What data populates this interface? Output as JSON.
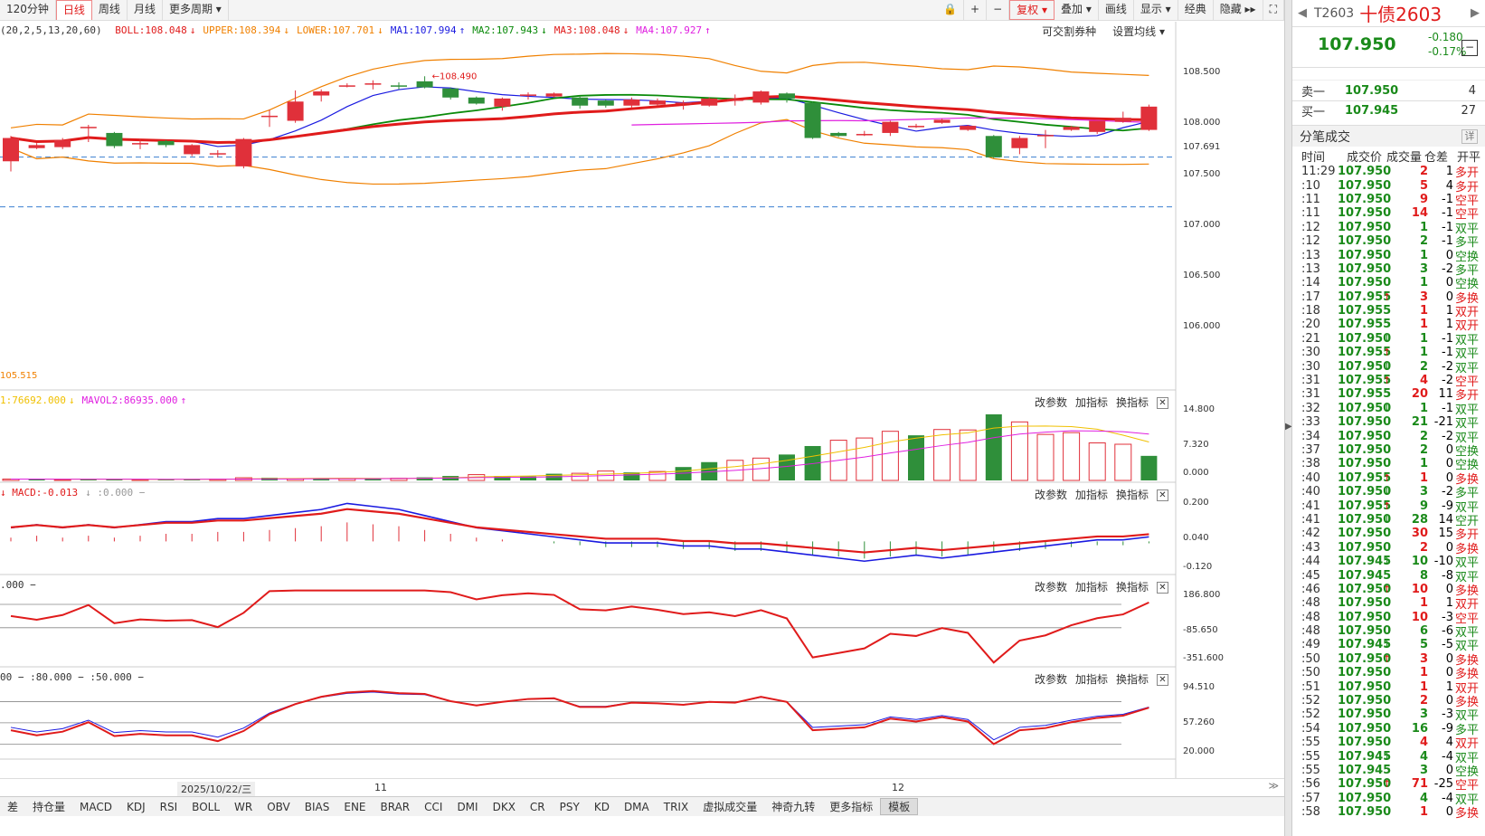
{
  "toolbar": {
    "periods": [
      "120分钟",
      "日线",
      "周线",
      "月线",
      "更多周期 ▾"
    ],
    "active_period": "日线",
    "right_buttons": [
      "🔒",
      "+",
      "−",
      "复权 ▾",
      "叠加 ▾",
      "画线",
      "显示 ▾",
      "经典",
      "隐藏 ▸▸",
      "⛶"
    ],
    "active_right": "复权 ▾"
  },
  "main_indicator": {
    "params": "(20,2,5,13,20,60)",
    "items": [
      {
        "text": "BOLL:108.048",
        "color": "#e01b1b",
        "arrow": "↓"
      },
      {
        "text": "UPPER:108.394",
        "color": "#f08000",
        "arrow": "↓"
      },
      {
        "text": "LOWER:107.701",
        "color": "#f08000",
        "arrow": "↓"
      },
      {
        "text": "MA1:107.994",
        "color": "#1a1ae0",
        "arrow": "↑"
      },
      {
        "text": "MA2:107.943",
        "color": "#0a8a0a",
        "arrow": "↓"
      },
      {
        "text": "MA3:108.048",
        "color": "#e01b1b",
        "arrow": "↓"
      },
      {
        "text": "MA4:107.927",
        "color": "#e020e0",
        "arrow": "↑"
      }
    ],
    "right_links": [
      "可交割券种",
      "设置均线 ▾"
    ],
    "y_labels": [
      "108.500",
      "108.000",
      "107.691",
      "107.500",
      "107.000",
      "106.500",
      "106.000"
    ],
    "high_marker": "108.490",
    "low_marker": "105.515"
  },
  "volume_pane": {
    "legend": [
      {
        "text": "1:76692.000",
        "color": "#f0c000",
        "arrow": "↓"
      },
      {
        "text": "MAVOL2:86935.000",
        "color": "#e020e0",
        "arrow": "↑"
      }
    ],
    "y_labels": [
      "14.800",
      "7.320",
      "0.000"
    ]
  },
  "macd_pane": {
    "legend": [
      {
        "text": "↓ MACD:-0.013",
        "color": "#e01b1b"
      },
      {
        "text": "↓ :0.000 −",
        "color": "#999"
      }
    ],
    "y_labels": [
      "0.200",
      "0.040",
      "-0.120"
    ]
  },
  "cci_pane": {
    "legend": [
      {
        "text": ".000 −",
        "color": "#333"
      }
    ],
    "y_labels": [
      "186.800",
      "-85.650",
      "-351.600"
    ]
  },
  "kdj_pane": {
    "legend": [
      {
        "text": "00 − :80.000 − :50.000 −",
        "color": "#333"
      }
    ],
    "y_labels": [
      "94.510",
      "57.260",
      "20.000"
    ]
  },
  "pane_controls": [
    "改参数",
    "加指标",
    "换指标"
  ],
  "date_axis": [
    "2025/10/22/三",
    "11",
    "12"
  ],
  "bottom_tabs": [
    "差",
    "持仓量",
    "MACD",
    "KDJ",
    "RSI",
    "BOLL",
    "WR",
    "OBV",
    "BIAS",
    "ENE",
    "BRAR",
    "CCI",
    "DMI",
    "DKX",
    "CR",
    "PSY",
    "KD",
    "DMA",
    "TRIX",
    "虚拟成交量",
    "神奇九转",
    "更多指标",
    "模板"
  ],
  "active_tab": "模板",
  "side": {
    "code": "T2603",
    "name": "十债2603",
    "price": "107.950",
    "change": "-0.180",
    "change_pct": "-0.17%",
    "mini_btn": "−",
    "sell1": {
      "label": "卖一",
      "price": "107.950",
      "vol": "4"
    },
    "buy1": {
      "label": "买一",
      "price": "107.945",
      "vol": "27"
    },
    "ticks_title": "分笔成交",
    "detail_btn": "详",
    "col_headers": [
      "时间",
      "成交价",
      "成交量",
      "仓差",
      "开平"
    ],
    "ticks": [
      [
        "11:29",
        "107.950",
        "",
        "2",
        "1",
        "多开"
      ],
      [
        ":10",
        "107.950",
        "",
        "5",
        "4",
        "多开"
      ],
      [
        ":11",
        "107.950",
        "",
        "9",
        "-1",
        "空平"
      ],
      [
        ":11",
        "107.950",
        "",
        "14",
        "-1",
        "空平"
      ],
      [
        ":12",
        "107.950",
        "",
        "1",
        "-1",
        "双平"
      ],
      [
        ":12",
        "107.950",
        "",
        "2",
        "-1",
        "多平"
      ],
      [
        ":13",
        "107.950",
        "",
        "1",
        "0",
        "空换"
      ],
      [
        ":13",
        "107.950",
        "",
        "3",
        "-2",
        "多平"
      ],
      [
        ":14",
        "107.950",
        "",
        "1",
        "0",
        "空换"
      ],
      [
        ":17",
        "107.955",
        "↑",
        "3",
        "0",
        "多换"
      ],
      [
        ":18",
        "107.955",
        "",
        "1",
        "1",
        "双开"
      ],
      [
        ":20",
        "107.955",
        "",
        "1",
        "1",
        "双开"
      ],
      [
        ":21",
        "107.950",
        "↓",
        "1",
        "-1",
        "双平"
      ],
      [
        ":30",
        "107.955",
        "↑",
        "1",
        "-1",
        "双平"
      ],
      [
        ":30",
        "107.950",
        "↓",
        "2",
        "-2",
        "双平"
      ],
      [
        ":31",
        "107.955",
        "↑",
        "4",
        "-2",
        "空平"
      ],
      [
        ":31",
        "107.955",
        "",
        "20",
        "11",
        "多开"
      ],
      [
        ":32",
        "107.950",
        "↓",
        "1",
        "-1",
        "双平"
      ],
      [
        ":33",
        "107.950",
        "",
        "21",
        "-21",
        "双平"
      ],
      [
        ":34",
        "107.950",
        "",
        "2",
        "-2",
        "双平"
      ],
      [
        ":37",
        "107.950",
        "",
        "2",
        "0",
        "空换"
      ],
      [
        ":38",
        "107.950",
        "",
        "1",
        "0",
        "空换"
      ],
      [
        ":40",
        "107.955",
        "↑",
        "1",
        "0",
        "多换"
      ],
      [
        ":40",
        "107.950",
        "↓",
        "3",
        "-2",
        "多平"
      ],
      [
        ":41",
        "107.955",
        "↑",
        "9",
        "-9",
        "双平"
      ],
      [
        ":41",
        "107.950",
        "↓",
        "28",
        "14",
        "空开"
      ],
      [
        ":42",
        "107.950",
        "",
        "30",
        "15",
        "多开"
      ],
      [
        ":43",
        "107.950",
        "",
        "2",
        "0",
        "多换"
      ],
      [
        ":44",
        "107.945",
        "↓",
        "10",
        "-10",
        "双平"
      ],
      [
        ":45",
        "107.945",
        "",
        "8",
        "-8",
        "双平"
      ],
      [
        ":46",
        "107.950",
        "↑",
        "10",
        "0",
        "多换"
      ],
      [
        ":48",
        "107.950",
        "",
        "1",
        "1",
        "双开"
      ],
      [
        ":48",
        "107.950",
        "",
        "10",
        "-3",
        "空平"
      ],
      [
        ":48",
        "107.950",
        "",
        "6",
        "-6",
        "双平"
      ],
      [
        ":49",
        "107.945",
        "↓",
        "5",
        "-5",
        "双平"
      ],
      [
        ":50",
        "107.950",
        "↑",
        "3",
        "0",
        "多换"
      ],
      [
        ":50",
        "107.950",
        "",
        "1",
        "0",
        "多换"
      ],
      [
        ":51",
        "107.950",
        "",
        "1",
        "1",
        "双开"
      ],
      [
        ":52",
        "107.950",
        "",
        "2",
        "0",
        "多换"
      ],
      [
        ":52",
        "107.950",
        "",
        "3",
        "-3",
        "双平"
      ],
      [
        ":54",
        "107.950",
        "",
        "16",
        "-9",
        "多平"
      ],
      [
        ":55",
        "107.950",
        "",
        "4",
        "4",
        "双开"
      ],
      [
        ":55",
        "107.945",
        "↓",
        "4",
        "-4",
        "双平"
      ],
      [
        ":55",
        "107.945",
        "",
        "3",
        "0",
        "空换"
      ],
      [
        ":56",
        "107.950",
        "↑",
        "71",
        "-25",
        "空平"
      ],
      [
        ":57",
        "107.950",
        "",
        "4",
        "-4",
        "双平"
      ],
      [
        ":58",
        "107.950",
        "",
        "1",
        "0",
        "多换"
      ]
    ]
  },
  "chart_data": {
    "type": "candlestick",
    "candles": [
      {
        "o": 107.65,
        "c": 107.88,
        "h": 107.9,
        "l": 107.55
      },
      {
        "o": 107.78,
        "c": 107.81,
        "h": 107.83,
        "l": 107.77
      },
      {
        "o": 107.79,
        "c": 107.86,
        "h": 107.88,
        "l": 107.77
      },
      {
        "o": 107.99,
        "c": 107.99,
        "h": 108.01,
        "l": 107.84
      },
      {
        "o": 107.93,
        "c": 107.8,
        "h": 107.94,
        "l": 107.78
      },
      {
        "o": 107.82,
        "c": 107.83,
        "h": 107.87,
        "l": 107.77
      },
      {
        "o": 107.85,
        "c": 107.81,
        "h": 107.86,
        "l": 107.79
      },
      {
        "o": 107.72,
        "c": 107.81,
        "h": 107.82,
        "l": 107.7
      },
      {
        "o": 107.73,
        "c": 107.73,
        "h": 107.76,
        "l": 107.69
      },
      {
        "o": 107.6,
        "c": 107.87,
        "h": 107.88,
        "l": 107.58
      },
      {
        "o": 108.1,
        "c": 108.1,
        "h": 108.16,
        "l": 107.99
      },
      {
        "o": 108.05,
        "c": 108.24,
        "h": 108.35,
        "l": 108.03
      },
      {
        "o": 108.3,
        "c": 108.34,
        "h": 108.36,
        "l": 108.24
      },
      {
        "o": 108.39,
        "c": 108.4,
        "h": 108.42,
        "l": 108.38
      },
      {
        "o": 108.42,
        "c": 108.42,
        "h": 108.45,
        "l": 108.36
      },
      {
        "o": 108.4,
        "c": 108.39,
        "h": 108.43,
        "l": 108.36
      },
      {
        "o": 108.44,
        "c": 108.38,
        "h": 108.49,
        "l": 108.37
      },
      {
        "o": 108.37,
        "c": 108.28,
        "h": 108.38,
        "l": 108.26
      },
      {
        "o": 108.28,
        "c": 108.22,
        "h": 108.29,
        "l": 108.21
      },
      {
        "o": 108.19,
        "c": 108.27,
        "h": 108.28,
        "l": 108.15
      },
      {
        "o": 108.31,
        "c": 108.31,
        "h": 108.33,
        "l": 108.26
      },
      {
        "o": 108.29,
        "c": 108.32,
        "h": 108.33,
        "l": 108.28
      },
      {
        "o": 108.28,
        "c": 108.2,
        "h": 108.3,
        "l": 108.17
      },
      {
        "o": 108.25,
        "c": 108.2,
        "h": 108.26,
        "l": 108.18
      },
      {
        "o": 108.2,
        "c": 108.26,
        "h": 108.28,
        "l": 108.18
      },
      {
        "o": 108.21,
        "c": 108.25,
        "h": 108.27,
        "l": 108.2
      },
      {
        "o": 108.22,
        "c": 108.23,
        "h": 108.25,
        "l": 108.16
      },
      {
        "o": 108.2,
        "c": 108.27,
        "h": 108.28,
        "l": 108.19
      },
      {
        "o": 108.25,
        "c": 108.26,
        "h": 108.31,
        "l": 108.2
      },
      {
        "o": 108.23,
        "c": 108.34,
        "h": 108.35,
        "l": 108.21
      },
      {
        "o": 108.32,
        "c": 108.27,
        "h": 108.33,
        "l": 108.23
      },
      {
        "o": 108.23,
        "c": 107.88,
        "h": 108.24,
        "l": 107.87
      },
      {
        "o": 107.93,
        "c": 107.9,
        "h": 107.94,
        "l": 107.89
      },
      {
        "o": 107.92,
        "c": 107.92,
        "h": 107.95,
        "l": 107.9
      },
      {
        "o": 107.93,
        "c": 108.04,
        "h": 108.05,
        "l": 107.9
      },
      {
        "o": 108.0,
        "c": 108.0,
        "h": 108.02,
        "l": 107.98
      },
      {
        "o": 108.03,
        "c": 108.06,
        "h": 108.07,
        "l": 108.02
      },
      {
        "o": 107.96,
        "c": 108.0,
        "h": 108.01,
        "l": 107.95
      },
      {
        "o": 107.9,
        "c": 107.69,
        "h": 107.91,
        "l": 107.68
      },
      {
        "o": 107.78,
        "c": 107.88,
        "h": 107.9,
        "l": 107.72
      },
      {
        "o": 107.9,
        "c": 107.91,
        "h": 107.96,
        "l": 107.78
      },
      {
        "o": 107.96,
        "c": 107.99,
        "h": 108.0,
        "l": 107.95
      },
      {
        "o": 107.94,
        "c": 108.05,
        "h": 108.05,
        "l": 107.92
      },
      {
        "o": 108.04,
        "c": 108.08,
        "h": 108.14,
        "l": 108.03
      },
      {
        "o": 107.96,
        "c": 108.19,
        "h": 108.21,
        "l": 107.95
      }
    ],
    "y_range": [
      105.4,
      108.85
    ],
    "dashed_levels": [
      107.691,
      107.2
    ],
    "volume": [
      0.3,
      0.3,
      0.2,
      0.3,
      0.3,
      0.2,
      0.2,
      0.3,
      0.3,
      0.6,
      0.6,
      0.4,
      0.5,
      0.4,
      0.4,
      0.5,
      0.7,
      1.0,
      1.3,
      1.0,
      0.9,
      1.5,
      1.6,
      2.1,
      1.8,
      2.0,
      3.0,
      4.1,
      4.5,
      5.0,
      5.8,
      7.7,
      9.0,
      9.5,
      11.0,
      10.1,
      11.4,
      11.3,
      14.8,
      13.1,
      10.3,
      10.7,
      8.4,
      8.1,
      5.5
    ],
    "volume_up": [
      true,
      false,
      true,
      false,
      false,
      true,
      false,
      false,
      true,
      true,
      false,
      true,
      false,
      true,
      false,
      true,
      false,
      false,
      true,
      false,
      false,
      false,
      true,
      true,
      false,
      true,
      false,
      false,
      true,
      true,
      false,
      false,
      true,
      true,
      true,
      false,
      true,
      true,
      false,
      true,
      true,
      true,
      true,
      true,
      false
    ],
    "volume_range": [
      0,
      16
    ],
    "macd_hist": [
      0.02,
      0.03,
      0.02,
      0.03,
      0.02,
      0.03,
      0.04,
      0.04,
      0.05,
      0.05,
      0.06,
      0.07,
      0.08,
      0.1,
      0.09,
      0.08,
      0.06,
      0.04,
      0.02,
      0.01,
      0.0,
      -0.01,
      -0.02,
      -0.03,
      -0.03,
      -0.03,
      -0.04,
      -0.04,
      -0.05,
      -0.05,
      -0.06,
      -0.07,
      -0.08,
      -0.09,
      -0.08,
      -0.07,
      -0.08,
      -0.07,
      -0.06,
      -0.05,
      -0.04,
      -0.03,
      -0.02,
      -0.02,
      -0.01
    ],
    "macd_range": [
      -0.16,
      0.24
    ],
    "cci_range": [
      -420,
      240
    ],
    "kdj_range": [
      0,
      110
    ]
  }
}
